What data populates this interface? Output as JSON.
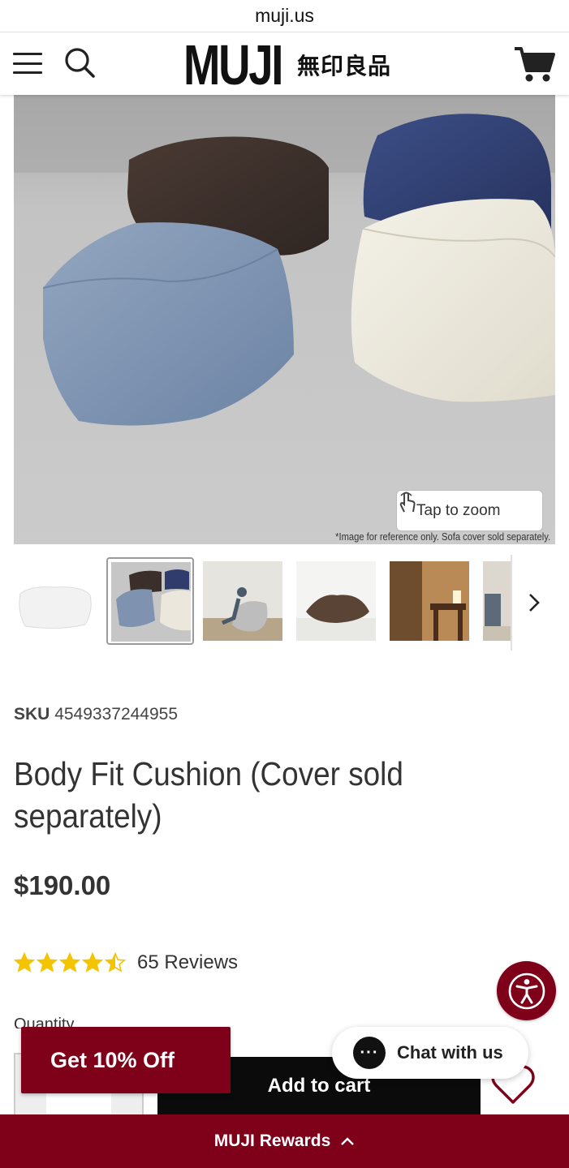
{
  "browser": {
    "url": "muji.us"
  },
  "header": {
    "logo_latin": "MUJI",
    "logo_kanji": "無印良品",
    "menu_icon": "hamburger-menu-icon",
    "search_icon": "search-icon",
    "cart_icon": "cart-icon"
  },
  "hero": {
    "zoom_label": "Tap to zoom",
    "caption": "*Image for reference only. Sofa cover sold separately."
  },
  "thumbnails": {
    "count_visible": 6,
    "selected_index": 1,
    "next_icon": "chevron-right-icon"
  },
  "product": {
    "sku_label": "SKU",
    "sku_value": "4549337244955",
    "title": "Body Fit Cushion (Cover sold separately)",
    "price": "$190.00",
    "rating_value": 4.5,
    "rating_max": 5,
    "reviews_label": "65 Reviews",
    "quantity_label": "Quantity",
    "add_to_cart_label": "Add to cart",
    "wishlist_icon": "heart-icon"
  },
  "promo": {
    "get_off_label": "Get 10% Off"
  },
  "chat": {
    "label": "Chat with us",
    "bubble_text": "···"
  },
  "rewards": {
    "label": "MUJI Rewards"
  },
  "colors": {
    "brand": "#7f0019",
    "cart_button": "#0b0b0b",
    "star": "#f5c400"
  }
}
